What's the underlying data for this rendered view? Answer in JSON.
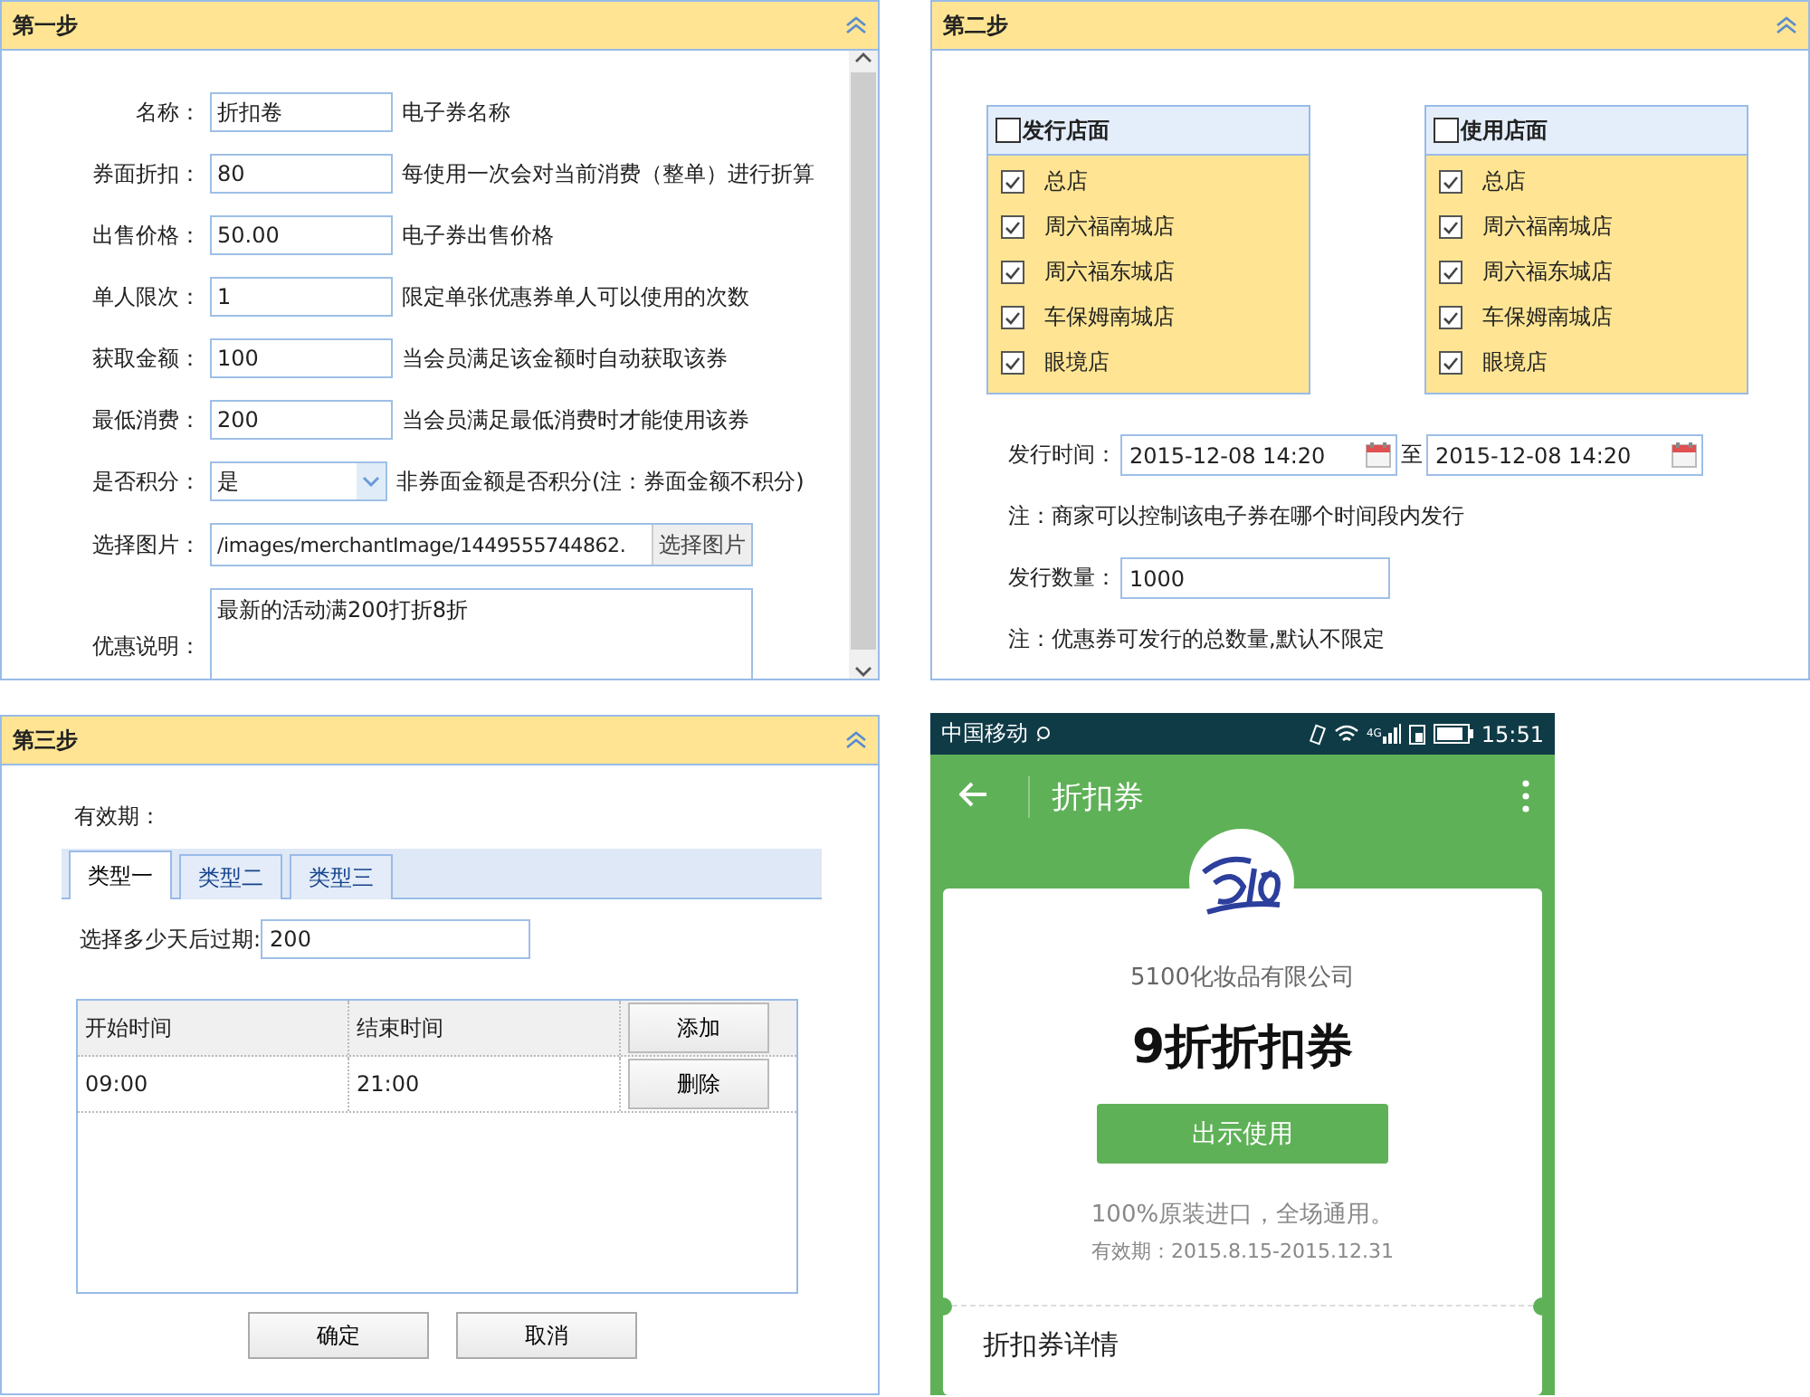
{
  "step1": {
    "title": "第一步",
    "fields": [
      {
        "kind": "text",
        "label": "名称：",
        "value": "折扣卷",
        "hint": "电子券名称"
      },
      {
        "kind": "text",
        "label": "券面折扣：",
        "value": "80",
        "hint": "每使用一次会对当前消费（整单）进行折算"
      },
      {
        "kind": "text",
        "label": "出售价格：",
        "value": "50.00",
        "hint": "电子券出售价格"
      },
      {
        "kind": "text",
        "label": "单人限次：",
        "value": "1",
        "hint": "限定单张优惠券单人可以使用的次数"
      },
      {
        "kind": "text",
        "label": "获取金额：",
        "value": "100",
        "hint": "当会员满足该金额时自动获取该券"
      },
      {
        "kind": "text",
        "label": "最低消费：",
        "value": "200",
        "hint": "当会员满足最低消费时才能使用该券"
      },
      {
        "kind": "select",
        "label": "是否积分：",
        "value": "是",
        "hint": "非券面金额是否积分(注：券面金额不积分)"
      },
      {
        "kind": "file",
        "label": "选择图片：",
        "value": "/images/merchantImage/1449555744862.",
        "button": "选择图片"
      },
      {
        "kind": "textarea",
        "label": "优惠说明：",
        "value": "最新的活动满200打折8折"
      }
    ]
  },
  "step2": {
    "title": "第二步",
    "store_lists": [
      {
        "header": "发行店面",
        "checked": false,
        "items": [
          {
            "label": "总店",
            "checked": true
          },
          {
            "label": "周六福南城店",
            "checked": true
          },
          {
            "label": "周六福东城店",
            "checked": true
          },
          {
            "label": "车保姆南城店",
            "checked": true
          },
          {
            "label": "眼境店",
            "checked": true
          }
        ]
      },
      {
        "header": "使用店面",
        "checked": false,
        "items": [
          {
            "label": "总店",
            "checked": true
          },
          {
            "label": "周六福南城店",
            "checked": true
          },
          {
            "label": "周六福东城店",
            "checked": true
          },
          {
            "label": "车保姆南城店",
            "checked": true
          },
          {
            "label": "眼境店",
            "checked": true
          }
        ]
      }
    ],
    "issue_time": {
      "label": "发行时间：",
      "from": "2015-12-08 14:20",
      "separator": "至",
      "to": "2015-12-08 14:20"
    },
    "time_note": "注：商家可以控制该电子券在哪个时间段内发行",
    "quantity": {
      "label": "发行数量：",
      "value": "1000"
    },
    "quantity_note": "注：优惠券可发行的总数量,默认不限定"
  },
  "step3": {
    "title": "第三步",
    "validity_label": "有效期：",
    "tabs": [
      {
        "label": "类型一",
        "selected": true
      },
      {
        "label": "类型二",
        "selected": false
      },
      {
        "label": "类型三",
        "selected": false
      }
    ],
    "days": {
      "label": "选择多少天后过期:",
      "value": "200"
    },
    "table": {
      "columns": [
        "开始时间",
        "结束时间"
      ],
      "add_button": "添加",
      "rows": [
        {
          "cells": [
            "09:00",
            "21:00"
          ],
          "button": "删除"
        }
      ]
    },
    "buttons": [
      "确定",
      "取消"
    ]
  },
  "phone": {
    "status_bar": {
      "carrier": "中国移动",
      "network": "4G",
      "time": "15:51"
    },
    "app_bar": {
      "title": "折扣券"
    },
    "company": "5100化妆品有限公司",
    "coupon_title": "9折折扣券",
    "use_button": "出示使用",
    "description": "100%原装进口，全场通用。",
    "validity": "有效期：2015.8.15-2015.12.31",
    "details_heading": "折扣券详情"
  }
}
